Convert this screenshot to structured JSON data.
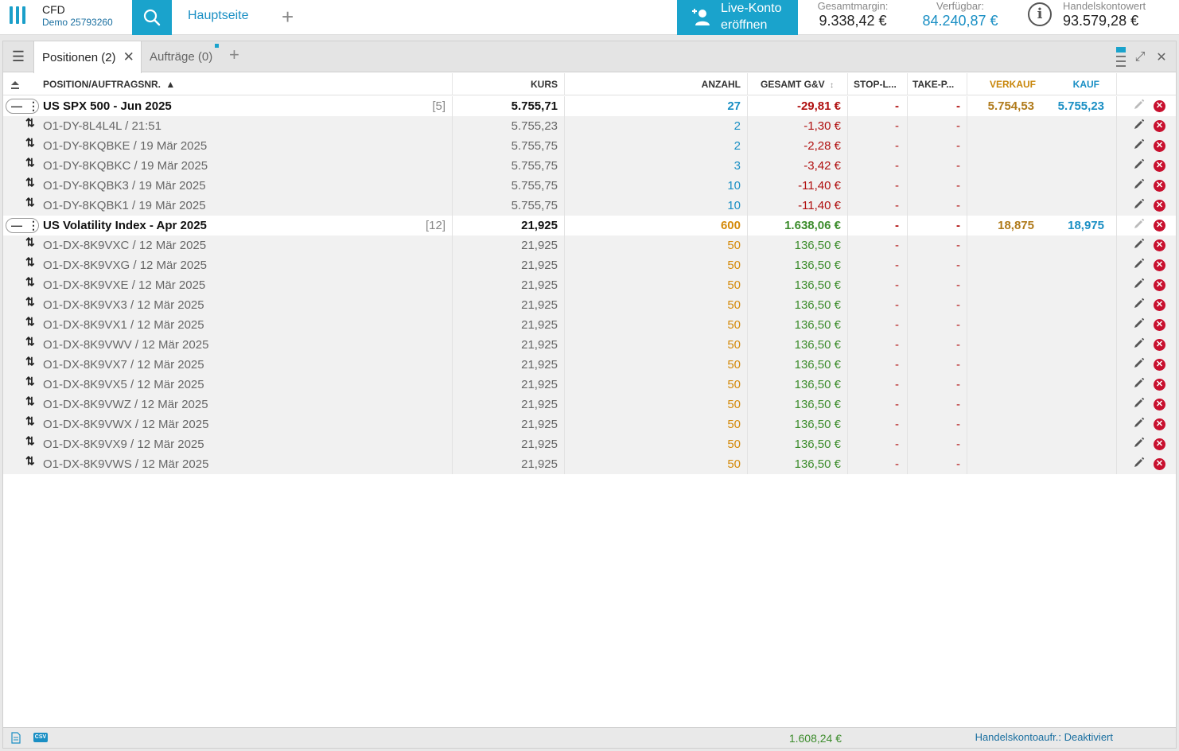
{
  "header": {
    "brand_title": "CFD",
    "brand_sub": "Demo 25793260",
    "home_tab": "Hauptseite",
    "add_tab": "+",
    "live_line1": "Live-Konto",
    "live_line2": "eröffnen",
    "stats": [
      {
        "label": "Gesamtmargin:",
        "value": "9.338,42 €"
      },
      {
        "label": "Verfügbar:",
        "value": "84.240,87 €"
      }
    ],
    "account_label": "Handelskontowert",
    "account_value": "93.579,28 €"
  },
  "tabs": {
    "positions": "Positionen (2)",
    "orders": "Aufträge (0)"
  },
  "columns": {
    "position": "POSITION/AUFTRAGSNR.",
    "kurs": "KURS",
    "anzahl": "ANZAHL",
    "gesamt": "GESAMT G&V",
    "stop": "STOP-L...",
    "take": "TAKE-P...",
    "verkauf": "VERKAUF",
    "kauf": "KAUF"
  },
  "groups": [
    {
      "name": "US SPX 500 - Jun 2025",
      "count": "[5]",
      "kurs": "5.755,71",
      "anzahl": "27",
      "pnl": "-29,81 €",
      "stop": "-",
      "take": "-",
      "verkauf": "5.754,53",
      "kauf": "5.755,23",
      "qty_class": "qty-blue",
      "pnl_class": "neg",
      "children": [
        {
          "id": "O1-DY-8L4L4L / 21:51",
          "kurs": "5.755,23",
          "anzahl": "2",
          "pnl": "-1,30 €",
          "stop": "-",
          "take": "-"
        },
        {
          "id": "O1-DY-8KQBKE / 19 Mär 2025",
          "kurs": "5.755,75",
          "anzahl": "2",
          "pnl": "-2,28 €",
          "stop": "-",
          "take": "-"
        },
        {
          "id": "O1-DY-8KQBKC / 19 Mär 2025",
          "kurs": "5.755,75",
          "anzahl": "3",
          "pnl": "-3,42 €",
          "stop": "-",
          "take": "-"
        },
        {
          "id": "O1-DY-8KQBK3 / 19 Mär 2025",
          "kurs": "5.755,75",
          "anzahl": "10",
          "pnl": "-11,40 €",
          "stop": "-",
          "take": "-"
        },
        {
          "id": "O1-DY-8KQBK1 / 19 Mär 2025",
          "kurs": "5.755,75",
          "anzahl": "10",
          "pnl": "-11,40 €",
          "stop": "-",
          "take": "-"
        }
      ]
    },
    {
      "name": "US Volatility Index - Apr 2025",
      "count": "[12]",
      "kurs": "21,925",
      "anzahl": "600",
      "pnl": "1.638,06 €",
      "stop": "-",
      "take": "-",
      "verkauf": "18,875",
      "kauf": "18,975",
      "qty_class": "qty-orange",
      "pnl_class": "pos",
      "children": [
        {
          "id": "O1-DX-8K9VXC / 12 Mär 2025",
          "kurs": "21,925",
          "anzahl": "50",
          "pnl": "136,50 €",
          "stop": "-",
          "take": "-"
        },
        {
          "id": "O1-DX-8K9VXG / 12 Mär 2025",
          "kurs": "21,925",
          "anzahl": "50",
          "pnl": "136,50 €",
          "stop": "-",
          "take": "-"
        },
        {
          "id": "O1-DX-8K9VXE / 12 Mär 2025",
          "kurs": "21,925",
          "anzahl": "50",
          "pnl": "136,50 €",
          "stop": "-",
          "take": "-"
        },
        {
          "id": "O1-DX-8K9VX3 / 12 Mär 2025",
          "kurs": "21,925",
          "anzahl": "50",
          "pnl": "136,50 €",
          "stop": "-",
          "take": "-"
        },
        {
          "id": "O1-DX-8K9VX1 / 12 Mär 2025",
          "kurs": "21,925",
          "anzahl": "50",
          "pnl": "136,50 €",
          "stop": "-",
          "take": "-"
        },
        {
          "id": "O1-DX-8K9VWV / 12 Mär 2025",
          "kurs": "21,925",
          "anzahl": "50",
          "pnl": "136,50 €",
          "stop": "-",
          "take": "-"
        },
        {
          "id": "O1-DX-8K9VX7 / 12 Mär 2025",
          "kurs": "21,925",
          "anzahl": "50",
          "pnl": "136,50 €",
          "stop": "-",
          "take": "-"
        },
        {
          "id": "O1-DX-8K9VX5 / 12 Mär 2025",
          "kurs": "21,925",
          "anzahl": "50",
          "pnl": "136,50 €",
          "stop": "-",
          "take": "-"
        },
        {
          "id": "O1-DX-8K9VWZ / 12 Mär 2025",
          "kurs": "21,925",
          "anzahl": "50",
          "pnl": "136,50 €",
          "stop": "-",
          "take": "-"
        },
        {
          "id": "O1-DX-8K9VWX / 12 Mär 2025",
          "kurs": "21,925",
          "anzahl": "50",
          "pnl": "136,50 €",
          "stop": "-",
          "take": "-"
        },
        {
          "id": "O1-DX-8K9VX9 / 12 Mär 2025",
          "kurs": "21,925",
          "anzahl": "50",
          "pnl": "136,50 €",
          "stop": "-",
          "take": "-"
        },
        {
          "id": "O1-DX-8K9VWS / 12 Mär 2025",
          "kurs": "21,925",
          "anzahl": "50",
          "pnl": "136,50 €",
          "stop": "-",
          "take": "-"
        }
      ]
    }
  ],
  "footer": {
    "csv_label": "CSV",
    "total": "1.608,24 €",
    "status": "Handelskontoaufr.: Deaktiviert"
  },
  "colors": {
    "accent": "#1aa3cc",
    "negative": "#b01010",
    "positive": "#3c8c2c",
    "delete": "#c8102e"
  }
}
